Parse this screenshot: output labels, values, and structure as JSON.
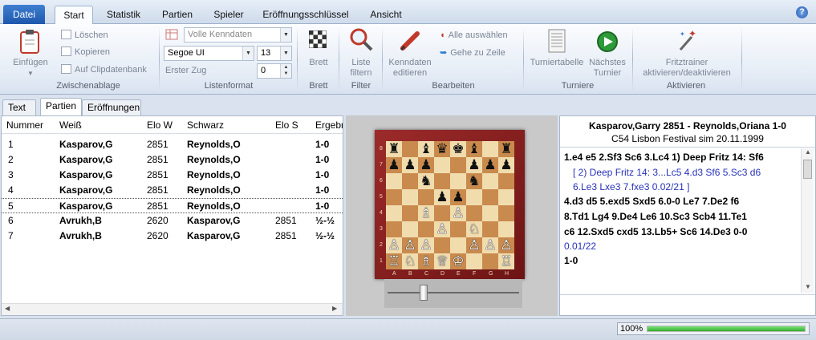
{
  "menubar": {
    "file": "Datei",
    "tabs": [
      "Start",
      "Statistik",
      "Partien",
      "Spieler",
      "Eröffnungsschlüssel",
      "Ansicht"
    ],
    "active_tab": "Start",
    "help": "?"
  },
  "ribbon": {
    "clipboard": {
      "paste": "Einfügen",
      "delete": "Löschen",
      "copy": "Kopieren",
      "clip_db": "Auf Clipdatenbank",
      "group": "Zwischenablage"
    },
    "listformat": {
      "columns_select": "Volle Kenndaten",
      "font": "Segoe UI",
      "font_size": "13",
      "first_move_label": "Erster Zug",
      "first_move": "0",
      "group": "Listenformat"
    },
    "board": {
      "button": "Brett",
      "group": "Brett"
    },
    "filter": {
      "button_line1": "Liste",
      "button_line2": "filtern",
      "group": "Filter"
    },
    "edit": {
      "edit_line1": "Kenndaten",
      "edit_line2": "editieren",
      "select_all": "Alle auswählen",
      "goto_line": "Gehe zu Zeile",
      "group": "Bearbeiten"
    },
    "tournaments": {
      "table": "Turniertabelle",
      "next_line1": "Nächstes",
      "next_line2": "Turnier",
      "group": "Turniere"
    },
    "activities": {
      "fritz_line1": "Fritztrainer",
      "fritz_line2": "aktivieren/deaktivieren",
      "group": "Aktivieren"
    }
  },
  "panel_tabs": [
    "Text",
    "Partien",
    "Eröffnungen"
  ],
  "game_list": {
    "columns": [
      "Nummer",
      "Weiß",
      "Elo W",
      "Schwarz",
      "Elo S",
      "Ergebn"
    ],
    "rows": [
      {
        "num": "1",
        "white": "Kasparov,G",
        "elo_w": "2851",
        "black": "Reynolds,O",
        "elo_b": "",
        "result": "1-0"
      },
      {
        "num": "2",
        "white": "Kasparov,G",
        "elo_w": "2851",
        "black": "Reynolds,O",
        "elo_b": "",
        "result": "1-0"
      },
      {
        "num": "3",
        "white": "Kasparov,G",
        "elo_w": "2851",
        "black": "Reynolds,O",
        "elo_b": "",
        "result": "1-0"
      },
      {
        "num": "4",
        "white": "Kasparov,G",
        "elo_w": "2851",
        "black": "Reynolds,O",
        "elo_b": "",
        "result": "1-0"
      },
      {
        "num": "5",
        "white": "Kasparov,G",
        "elo_w": "2851",
        "black": "Reynolds,O",
        "elo_b": "",
        "result": "1-0"
      },
      {
        "num": "6",
        "white": "Avrukh,B",
        "elo_w": "2620",
        "black": "Kasparov,G",
        "elo_b": "2851",
        "result": "½-½"
      },
      {
        "num": "7",
        "white": "Avrukh,B",
        "elo_w": "2620",
        "black": "Kasparov,G",
        "elo_b": "2851",
        "result": "½-½"
      }
    ],
    "selected_row": 5
  },
  "board": {
    "files": [
      "A",
      "B",
      "C",
      "D",
      "E",
      "F",
      "G",
      "H"
    ],
    "ranks": [
      "8",
      "7",
      "6",
      "5",
      "4",
      "3",
      "2",
      "1"
    ],
    "position": [
      "r.bqkb.r",
      "ppp..ppp",
      "..n..n..",
      "...pp...",
      "..B.P...",
      "...P.N..",
      "PPP..PPP",
      "RNBQK..R"
    ]
  },
  "notation": {
    "header_players": "Kasparov,Garry 2851 - Reynolds,Oriana 1-0",
    "header_event": "C54 Lisbon Festival sim 20.11.1999",
    "lines": [
      "1.e4  e5  2.Sf3  Sc6  3.Lc4  1) Deep Fritz 14: Sf6",
      "[ 2) Deep Fritz 14: 3...Lc5  4.d3  Sf6  5.Sc3  d6",
      "6.Le3  Lxe3  7.fxe3 0.02/21 ]",
      "4.d3  d5  5.exd5  Sxd5  6.0-0  Le7  7.De2  f6",
      "8.Td1  Lg4  9.De4  Le6  10.Sc3  Scb4  11.Te1",
      "c6  12.Sxd5  cxd5  13.Lb5+  Sc6  14.De3  0-0",
      "0.01/22",
      "1-0"
    ]
  },
  "status": {
    "zoom": "100%",
    "progress": 1.0
  }
}
